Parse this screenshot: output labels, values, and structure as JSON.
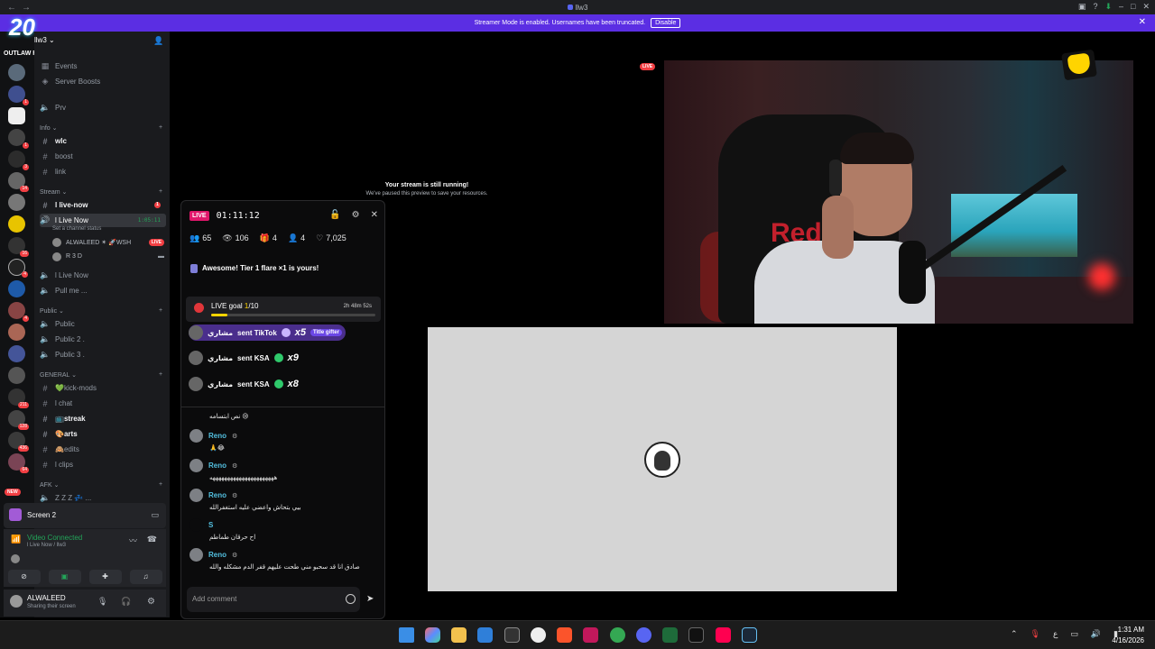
{
  "window": {
    "title": "llw3",
    "nav_back": "←",
    "nav_forward": "→",
    "min": "–",
    "restore": "□",
    "close": "✕"
  },
  "banner": {
    "text": "Streamer Mode is enabled. Usernames have been truncated.",
    "disable_label": "Disable",
    "close": "✕"
  },
  "server": {
    "name": "llw3",
    "logo_mark": "20",
    "logo_text": "OUTLAW RP",
    "new_label": "NEW",
    "rail_badges": [
      "1",
      "1",
      "3",
      "14",
      "16",
      "4",
      "4",
      "211",
      "128",
      "436",
      "64"
    ]
  },
  "sidebar": {
    "top": [
      {
        "icon": "calendar-icon",
        "label": "Events"
      },
      {
        "icon": "boost-icon",
        "label": "Server Boosts"
      },
      {
        "icon": "speaker-icon",
        "label": "Prv"
      }
    ],
    "categories": {
      "info": "Info",
      "stream": "Stream",
      "public": "Public",
      "general": "GENERAL",
      "afk": "AFK"
    },
    "info_channels": [
      {
        "label": "wlc",
        "bold": true
      },
      {
        "label": "boost",
        "bold": false
      },
      {
        "label": "link",
        "bold": false
      }
    ],
    "stream_channels": {
      "live_now_text": "l live-now",
      "live_now_badge": "1",
      "live_voice": "l Live Now",
      "live_voice_time": "1:05:11",
      "status_hint": "Set a channel status",
      "users": [
        {
          "name": "ALWALEED ✶ 🚀WSH",
          "live": "LIVE"
        },
        {
          "name": "R 3 D",
          "live": ""
        }
      ],
      "live_voice_2": "l Live Now",
      "pull_me": "Pull me ..."
    },
    "public_channels": [
      "Public",
      "Public 2 .",
      "Public 3 ."
    ],
    "general_channels": [
      {
        "label": "💚kick-mods",
        "bold": false
      },
      {
        "label": "l chat",
        "bold": false
      },
      {
        "label": "📺streak",
        "bold": true
      },
      {
        "label": "🎨arts",
        "bold": true
      },
      {
        "label": "🙈edits",
        "bold": false
      },
      {
        "label": "l clips",
        "bold": false
      }
    ],
    "afk_channel": "Z Z Z 💤 ..."
  },
  "screen_panel": {
    "label": "Screen 2"
  },
  "voice": {
    "status": "Video Connected",
    "channel": "l Live Now / llw3"
  },
  "user": {
    "name": "ALWALEED",
    "status": "Sharing their screen"
  },
  "stream": {
    "paused_title": "Your stream is still running!",
    "paused_sub": "We've paused this preview to save your resources.",
    "live_pill": "LIVE",
    "shirt_text": "Red B"
  },
  "chat": {
    "live_tag": "LIVE",
    "timer": "01:11:12",
    "stats": {
      "followers": "65",
      "viewers": "106",
      "gifts": "4",
      "subs": "4",
      "likes": "7,025"
    },
    "flare_text": "Awesome! Tier 1 flare ×1 is yours!",
    "goal": {
      "label": "LIVE goal ",
      "current": "1",
      "target": "/10",
      "time_left": "2h 48m 52s",
      "progress": 0.1
    },
    "gifts": [
      {
        "user": "مشاري",
        "text": "sent TikTok",
        "mult": "x5",
        "tag": "Title gifter"
      },
      {
        "user": "مشاري",
        "text": "sent KSA",
        "mult": "x9",
        "tag": ""
      },
      {
        "user": "مشاري",
        "text": "sent KSA",
        "mult": "x8",
        "tag": ""
      }
    ],
    "messages": [
      {
        "user": "",
        "text": "نص ابتسامه 😢"
      },
      {
        "user": "Reno",
        "text": "🙏😂"
      },
      {
        "user": "Reno",
        "text": "ههههههههههههههههههههههه"
      },
      {
        "user": "Reno",
        "text": "بيي بتحاش واعضي عليه استغفرالله"
      },
      {
        "user": "S",
        "text": "اح حرقان طماطم"
      },
      {
        "user": "Reno",
        "text": "صادق انا قد سحبو مني طحت عليهم قفر الدم مشكله والله"
      }
    ],
    "input_placeholder": "Add comment"
  },
  "taskbar": {
    "time": "1:31 AM",
    "date": "4/16/2026",
    "tray_lang": "ع"
  },
  "colors": {
    "banner": "#5b2ee3",
    "kick_green": "#53fc18",
    "live_red": "#f23f43",
    "chat_live": "#e1176b",
    "voice_green": "#23a559"
  }
}
